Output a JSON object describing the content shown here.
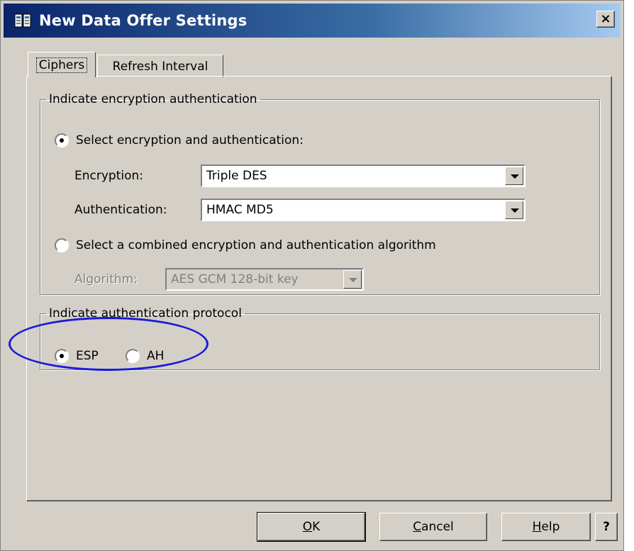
{
  "window": {
    "title": "New Data Offer Settings",
    "close_glyph": "×"
  },
  "tabs": [
    {
      "label": "Ciphers",
      "selected": true
    },
    {
      "label": "Refresh Interval",
      "selected": false
    }
  ],
  "encryption_group": {
    "legend": "Indicate encryption authentication",
    "option_select_label": "Select encryption and authentication:",
    "option_select_checked": true,
    "encryption_label": "Encryption:",
    "encryption_value": "Triple DES",
    "authentication_label": "Authentication:",
    "authentication_value": "HMAC MD5",
    "option_combined_label": "Select a combined encryption and authentication algorithm",
    "option_combined_checked": false,
    "algorithm_label": "Algorithm:",
    "algorithm_value": "AES GCM 128-bit key"
  },
  "protocol_group": {
    "legend": "Indicate authentication protocol",
    "esp_label": "ESP",
    "esp_checked": true,
    "ah_label": "AH",
    "ah_checked": false
  },
  "buttons": {
    "ok_mnemonic": "O",
    "ok_rest": "K",
    "cancel_mnemonic": "C",
    "cancel_rest": "ancel",
    "help_mnemonic": "H",
    "help_rest": "elp",
    "question": "?"
  },
  "colors": {
    "dialog_face": "#d4d0c8",
    "titlebar_start": "#0a246a",
    "annotation": "#1a1ad6"
  }
}
